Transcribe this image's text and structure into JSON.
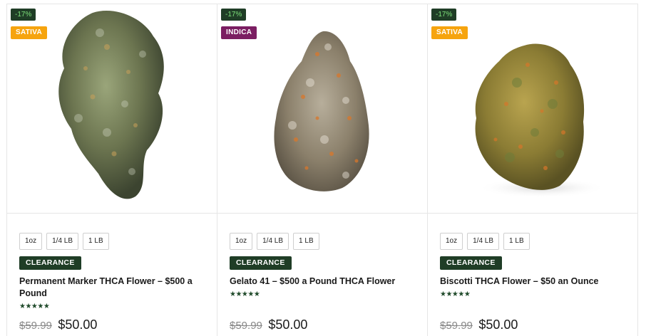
{
  "products": [
    {
      "discount": "-17%",
      "type": "SATIVA",
      "type_class": "sativa",
      "variants": [
        "1oz",
        "1/4 LB",
        "1 LB"
      ],
      "tag": "CLEARANCE",
      "title": "Permanent Marker THCA Flower – $500 a Pound",
      "rating_stars": "★★★★★",
      "old_price": "$59.99",
      "price": "$50.00",
      "image_icon": "cannabis-bud-image",
      "bud_color": "#6f7a4e"
    },
    {
      "discount": "-17%",
      "type": "INDICA",
      "type_class": "indica",
      "variants": [
        "1oz",
        "1/4 LB",
        "1 LB"
      ],
      "tag": "CLEARANCE",
      "title": "Gelato 41 – $500 a Pound THCA Flower",
      "rating_stars": "★★★★★",
      "old_price": "$59.99",
      "price": "$50.00",
      "image_icon": "cannabis-bud-image",
      "bud_color": "#8e8570"
    },
    {
      "discount": "-17%",
      "type": "SATIVA",
      "type_class": "sativa",
      "variants": [
        "1oz",
        "1/4 LB",
        "1 LB"
      ],
      "tag": "CLEARANCE",
      "title": "Biscotti THCA Flower – $50 an Ounce",
      "rating_stars": "★★★★★",
      "old_price": "$59.99",
      "price": "$50.00",
      "image_icon": "cannabis-bud-image",
      "bud_color": "#9a8a3c"
    }
  ]
}
